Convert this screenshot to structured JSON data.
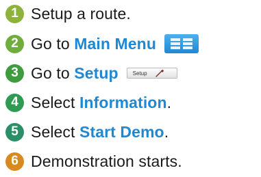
{
  "steps": [
    {
      "number": "1",
      "color": "#8db33a",
      "before": "Setup a route.",
      "highlight": "",
      "after": ""
    },
    {
      "number": "2",
      "color": "#6fae3c",
      "before": "Go to ",
      "highlight": "Main Menu",
      "after": ""
    },
    {
      "number": "3",
      "color": "#3f9c3e",
      "before": "Go to ",
      "highlight": "Setup",
      "after": ""
    },
    {
      "number": "4",
      "color": "#2f9a52",
      "before": "Select ",
      "highlight": "Information",
      "after": "."
    },
    {
      "number": "5",
      "color": "#2a8f67",
      "before": "Select ",
      "highlight": "Start Demo",
      "after": "."
    },
    {
      "number": "6",
      "color": "#d8891f",
      "before": "Demonstration starts.",
      "highlight": "",
      "after": ""
    }
  ],
  "main_menu_icon": "menu-grid-icon",
  "setup_button": {
    "label": "Setup",
    "icon": "wrench-icon"
  },
  "colors": {
    "highlight": "#1f88d4",
    "menu_icon": "#1f88d4"
  }
}
